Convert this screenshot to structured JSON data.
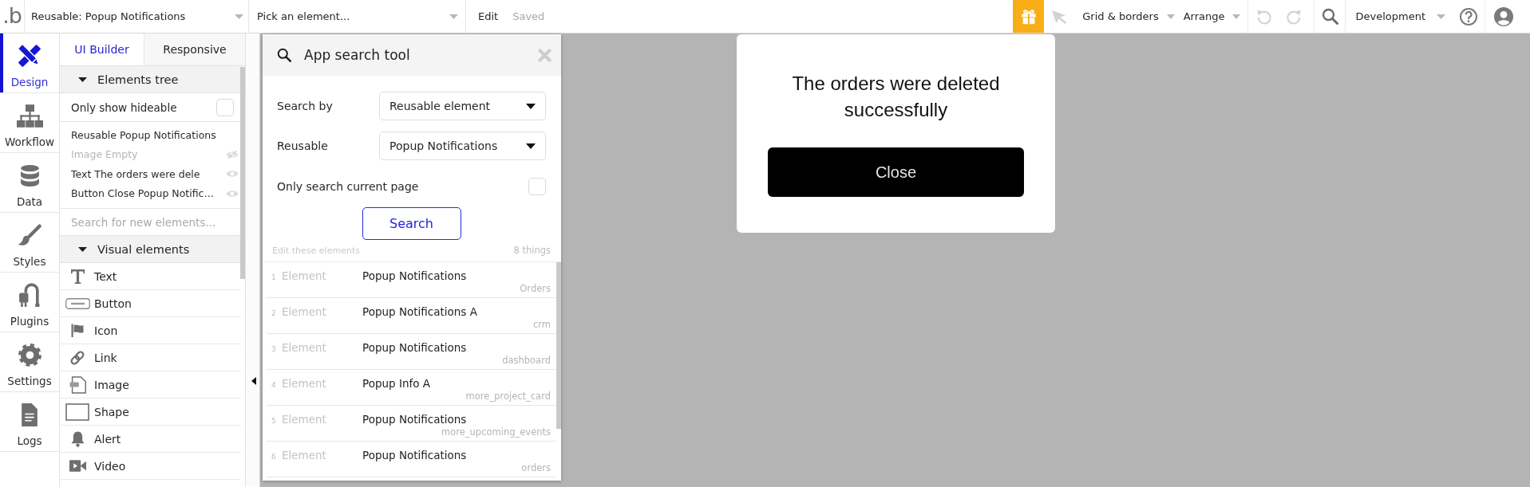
{
  "top_bar": {
    "logo": ".b",
    "page_dropdown": "Reusable: Popup Notifications",
    "element_dropdown": "Pick an element...",
    "edit_button": "Edit",
    "save_status": "Saved",
    "pointer_tool": {
      "disabled": true
    },
    "grid_menu": "Grid & borders",
    "arrange_menu": "Arrange",
    "undo": {
      "disabled": true
    },
    "redo": {
      "disabled": true
    },
    "version_menu": "Development"
  },
  "sidebar": {
    "items": [
      {
        "kind": "design",
        "label": "Design",
        "selected": true
      },
      {
        "kind": "workflow",
        "label": "Workflow",
        "selected": false
      },
      {
        "kind": "data",
        "label": "Data",
        "selected": false
      },
      {
        "kind": "styles",
        "label": "Styles",
        "selected": false
      },
      {
        "kind": "plugins",
        "label": "Plugins",
        "selected": false
      },
      {
        "kind": "settings",
        "label": "Settings",
        "selected": false
      },
      {
        "kind": "logs",
        "label": "Logs",
        "selected": false
      }
    ]
  },
  "panel": {
    "tabs": [
      {
        "label": "UI Builder",
        "selected": true
      },
      {
        "label": "Responsive",
        "selected": false
      }
    ],
    "elements_tree": {
      "title": "Elements tree",
      "expanded": true,
      "filter": {
        "label": "Only show hideable",
        "checked": false
      },
      "items": [
        {
          "label": "Reusable Popup Notifications",
          "hideable": false,
          "hidden": false
        },
        {
          "label": "Image Empty",
          "hideable": true,
          "hidden": true
        },
        {
          "label": "Text The orders were dele",
          "hideable": true,
          "hidden": false
        },
        {
          "label": "Button Close Popup Notific…",
          "hideable": true,
          "hidden": false
        }
      ]
    },
    "element_search": {
      "placeholder": "Search for new elements..."
    },
    "visual_elements": {
      "title": "Visual elements",
      "expanded": true,
      "items": [
        {
          "kind": "text",
          "label": "Text"
        },
        {
          "kind": "button",
          "label": "Button"
        },
        {
          "kind": "icon",
          "label": "Icon"
        },
        {
          "kind": "link",
          "label": "Link"
        },
        {
          "kind": "image",
          "label": "Image"
        },
        {
          "kind": "shape",
          "label": "Shape"
        },
        {
          "kind": "alert",
          "label": "Alert"
        },
        {
          "kind": "video",
          "label": "Video"
        }
      ]
    }
  },
  "search_tool": {
    "title": "App search tool",
    "search_by": {
      "label": "Search by",
      "value": "Reusable element"
    },
    "reusable": {
      "label": "Reusable",
      "value": "Popup Notifications"
    },
    "current_page_only": {
      "label": "Only search current page",
      "checked": false
    },
    "search_button": "Search",
    "results_caption": "Edit these elements",
    "results_count": "8 things",
    "results": [
      {
        "index": "1",
        "type": "Element",
        "name": "Popup Notifications",
        "page": "Orders"
      },
      {
        "index": "2",
        "type": "Element",
        "name": "Popup Notifications A",
        "page": "crm"
      },
      {
        "index": "3",
        "type": "Element",
        "name": "Popup Notifications",
        "page": "dashboard"
      },
      {
        "index": "4",
        "type": "Element",
        "name": "Popup Info A",
        "page": "more_project_card"
      },
      {
        "index": "5",
        "type": "Element",
        "name": "Popup Notifications",
        "page": "more_upcoming_events"
      },
      {
        "index": "6",
        "type": "Element",
        "name": "Popup Notifications",
        "page": "orders"
      }
    ]
  },
  "canvas": {
    "popup": {
      "message": "The orders were deleted successfully",
      "button": "Close"
    }
  }
}
